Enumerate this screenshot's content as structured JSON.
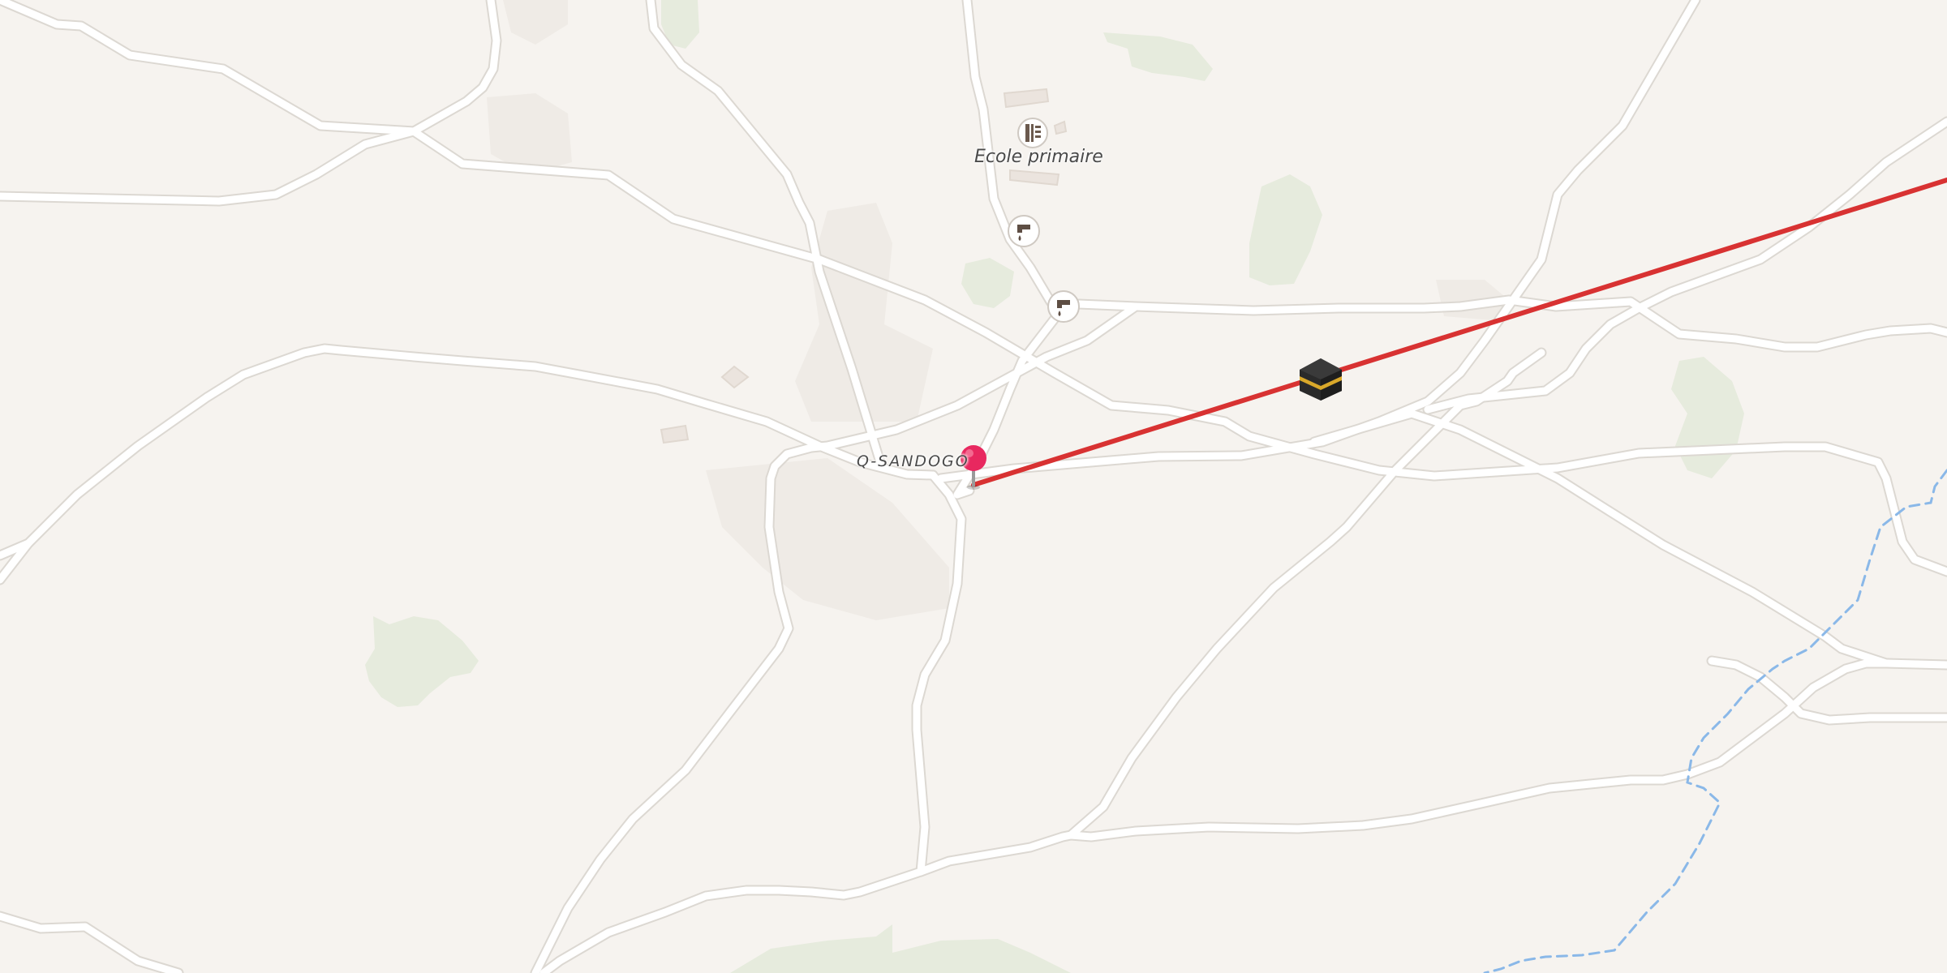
{
  "map": {
    "labels": {
      "village": "Q-SANDOGO",
      "school": "Ecole primaire"
    },
    "colors": {
      "background": "#f6f3ef",
      "road": "#ffffff",
      "road_casing": "#dcd8d2",
      "vegetation": "#e6ebdd",
      "route_line": "#d83232",
      "pin": "#e8285f",
      "stream": "#8ab8e8"
    },
    "icons": {
      "school": "school-icon",
      "water_tap_1": "water-tap-icon",
      "water_tap_2": "water-tap-icon",
      "destination": "kaaba-icon",
      "location_pin": "map-pin-icon"
    }
  }
}
